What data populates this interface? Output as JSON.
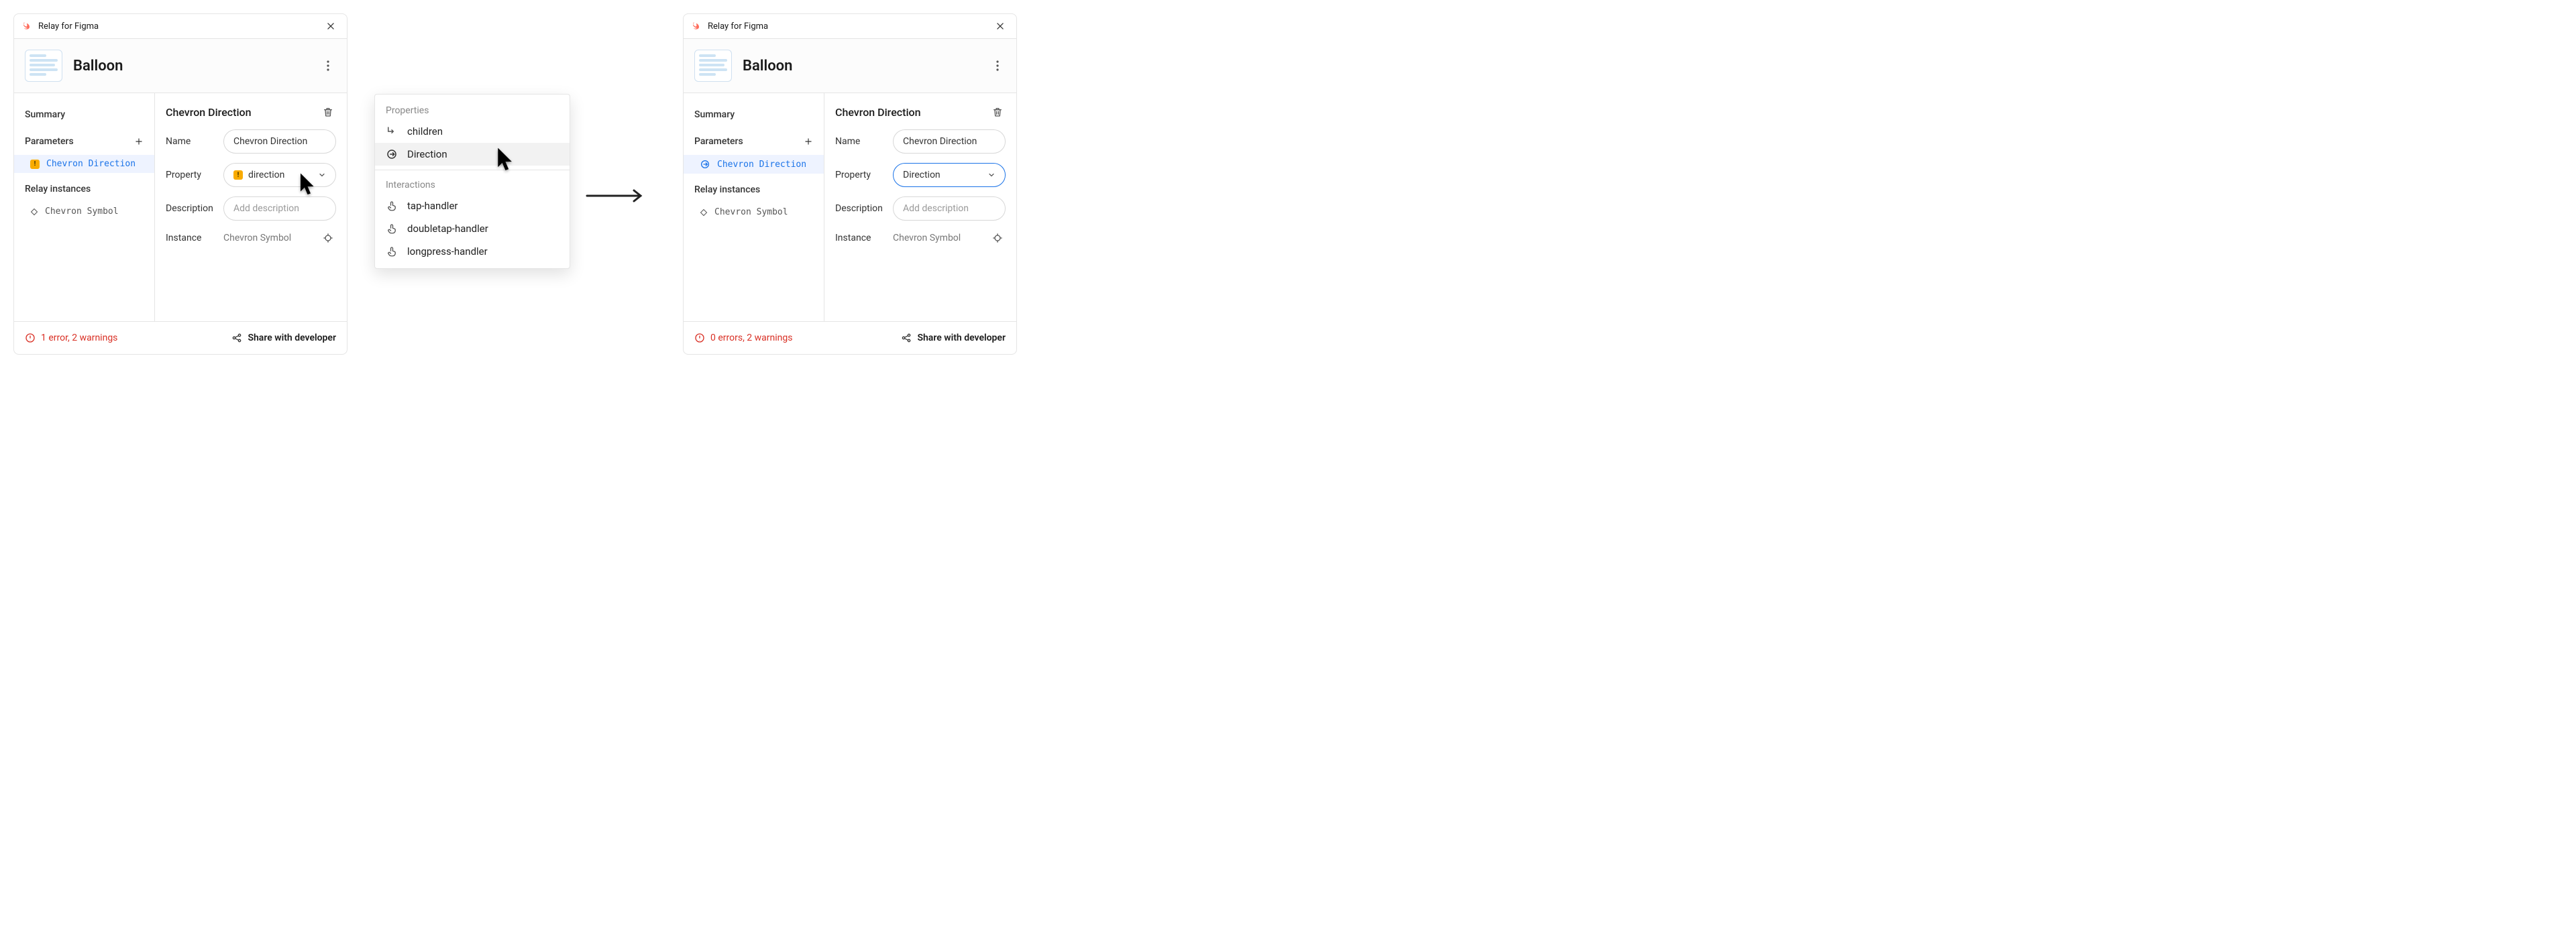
{
  "app_name": "Relay for Figma",
  "component_name": "Balloon",
  "sidebar": {
    "summary_label": "Summary",
    "parameters_label": "Parameters",
    "relay_instances_label": "Relay instances",
    "param_item": "Chevron Direction",
    "instance_item": "Chevron Symbol"
  },
  "detail": {
    "title": "Chevron Direction",
    "name_label": "Name",
    "property_label": "Property",
    "description_label": "Description",
    "instance_label": "Instance",
    "instance_value": "Chevron Symbol",
    "description_placeholder": "Add description"
  },
  "panel_left": {
    "name_value": "Chevron Direction",
    "property_value": "direction",
    "property_has_warning": true,
    "footer_status": "1 error, 2 warnings"
  },
  "panel_right": {
    "name_value": "Chevron Direction",
    "property_value": "Direction",
    "property_has_warning": false,
    "property_focused": true,
    "footer_status": "0 errors, 2 warnings"
  },
  "footer_share_label": "Share with developer",
  "popover": {
    "properties_heading": "Properties",
    "interactions_heading": "Interactions",
    "items_properties": [
      {
        "icon": "children-icon",
        "label": "children",
        "hover": false
      },
      {
        "icon": "direction-icon",
        "label": "Direction",
        "hover": true
      }
    ],
    "items_interactions": [
      {
        "icon": "tap-icon",
        "label": "tap-handler"
      },
      {
        "icon": "doubletap-icon",
        "label": "doubletap-handler"
      },
      {
        "icon": "longpress-icon",
        "label": "longpress-handler"
      }
    ]
  }
}
